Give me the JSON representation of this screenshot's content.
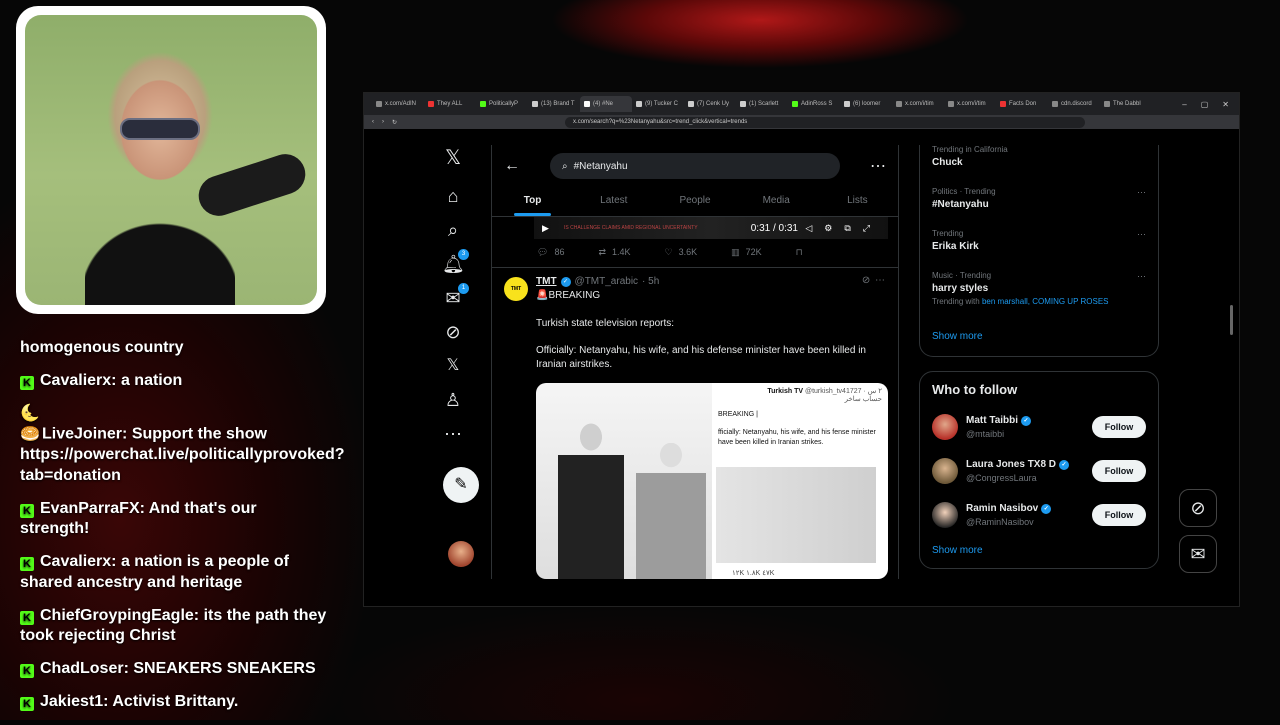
{
  "chat": {
    "messages": [
      {
        "user": "",
        "text": "homogenous country",
        "badge": "none"
      },
      {
        "user": "Cavalierx",
        "text": "a nation",
        "badge": "kick"
      },
      {
        "user": "LiveJoiner",
        "text": "Support the show https://powerchat.live/politicallyprovoked?tab=donation",
        "badge": "moon"
      },
      {
        "user": "EvanParraFX",
        "text": "And that's our strength!",
        "badge": "kick"
      },
      {
        "user": "Cavalierx",
        "text": "a nation is a people of shared ancestry and heritage",
        "badge": "kick"
      },
      {
        "user": "ChiefGroypingEagle",
        "text": "its the path they took rejecting Christ",
        "badge": "kick"
      },
      {
        "user": "ChadLoser",
        "text": "SNEAKERS SNEAKERS",
        "badge": "kick"
      },
      {
        "user": "Jakiest1",
        "text": "Activist Brittany.",
        "badge": "kick"
      }
    ]
  },
  "browser": {
    "tabs": [
      "x.com/AdIN",
      "They ALL",
      "PoliticallyP",
      "(13) Brand T",
      "(4) #Ne",
      "(9) Tucker C",
      "(7) Cenk Uy",
      "(1) Scarlett",
      "AdinRoss S",
      "(6) loomer",
      "x.com/i/tim",
      "x.com/i/tim",
      "Facts Don",
      "cdn.discord",
      "The Dabbl"
    ],
    "active_tab": 4,
    "url": "x.com/search?q=%23Netanyahu&src=trend_click&vertical=trends"
  },
  "x": {
    "search_value": "#Netanyahu",
    "tabs": [
      "Top",
      "Latest",
      "People",
      "Media",
      "Lists"
    ],
    "notif_badge": "3",
    "msg_badge": "1",
    "video": {
      "banner": "IS CHALLENGE CLAIMS AMID REGIONAL UNCERTAINTY",
      "time": "0:31 / 0:31"
    },
    "prev_actions": {
      "replies": "86",
      "reposts": "1.4K",
      "likes": "3.6K",
      "views": "72K"
    },
    "tweet": {
      "name": "TMT",
      "handle": "@TMT_arabic",
      "time": "· 5h",
      "avatar_text": "TMT",
      "line1": "🚨BREAKING",
      "line2": "Turkish state television reports:",
      "line3": "Officially: Netanyahu, his wife, and his defense minister have been killed in Iranian airstrikes.",
      "embed_account": "Turkish TV",
      "embed_handle": "@turkish_tv41727 · ٢ س",
      "embed_sub": "حساب ساخر",
      "embed_breaking": "BREAKING |",
      "embed_text": "fficially: Netanyahu, his wife, and his fense minister have been killed in Iranian strikes.",
      "embed_stats": "١٢K  ١.٨K  ٤٧K"
    },
    "trends": [
      {
        "context": "Trending in California",
        "topic": "Chuck",
        "with": ""
      },
      {
        "context": "Politics · Trending",
        "topic": "#Netanyahu",
        "with": ""
      },
      {
        "context": "Trending",
        "topic": "Erika Kirk",
        "with": ""
      },
      {
        "context": "Music · Trending",
        "topic": "harry styles",
        "with_prefix": "Trending with ",
        "with": "ben marshall, COMING UP ROSES"
      }
    ],
    "show_more": "Show more",
    "who_to_follow": {
      "title": "Who to follow",
      "people": [
        {
          "name": "Matt Taibbi",
          "handle": "@mtaibbi",
          "avatar_color": "#b8322a"
        },
        {
          "name": "Laura Jones TX8 D",
          "handle": "@CongressLaura",
          "avatar_color": "#6f5a3a"
        },
        {
          "name": "Ramin Nasibov",
          "handle": "@RaminNasibov",
          "avatar_color": "#d9d9d9"
        }
      ],
      "follow_label": "Follow",
      "show_more": "Show more"
    }
  }
}
